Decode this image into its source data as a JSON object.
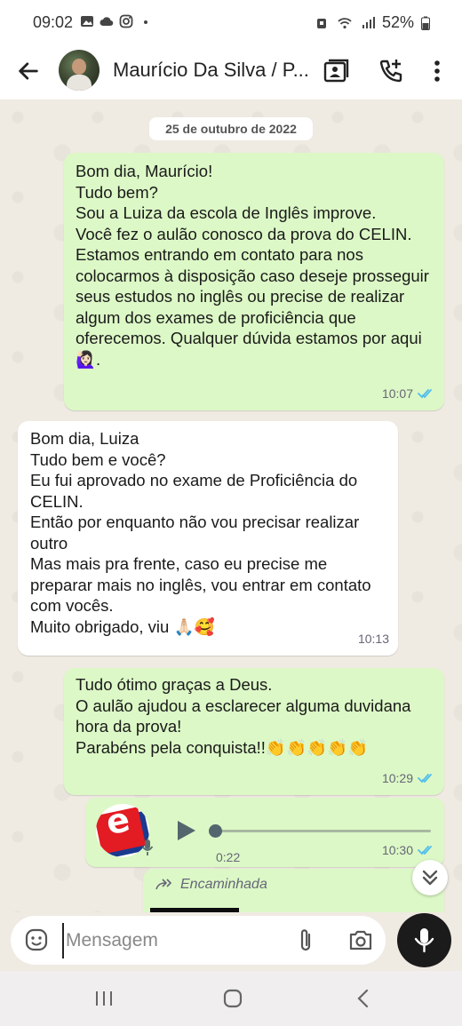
{
  "status_bar": {
    "time": "09:02",
    "battery": "52%"
  },
  "header": {
    "contact_name": "Maurício Da Silva / P..."
  },
  "chat": {
    "date": "25 de outubro de 2022",
    "messages": [
      {
        "direction": "outgoing",
        "text": "Bom dia, Maurício!\nTudo bem?\nSou a Luiza da escola de Inglês improve.\nVocê fez o aulão conosco da prova do CELIN.\nEstamos entrando em contato para nos colocarmos à disposição caso deseje prosseguir seus estudos no inglês ou precise de realizar algum dos exames de proficiência que oferecemos. Qualquer dúvida estamos por aqui 🙋🏻‍♀️.",
        "time": "10:07",
        "read": true
      },
      {
        "direction": "incoming",
        "text": "Bom dia, Luiza\nTudo bem e você?\nEu fui aprovado no exame de Proficiência do CELIN.\nEntão por enquanto não vou precisar realizar outro\nMas mais pra frente, caso eu precise me preparar mais no inglês, vou entrar em contato com vocês.\nMuito obrigado, viu 🙏🏻🥰",
        "time": "10:13"
      },
      {
        "direction": "outgoing",
        "text": "Tudo ótimo graças a Deus.\nO aulão ajudou a esclarecer alguma duvidana hora da prova!\nParabéns pela conquista!!👏👏👏👏👏",
        "time": "10:29",
        "read": true
      },
      {
        "direction": "outgoing",
        "type": "voice",
        "avatar_letter": "e",
        "duration": "0:22",
        "progress": 0,
        "time": "10:30",
        "read": true
      },
      {
        "direction": "outgoing",
        "type": "forwarded",
        "forwarded_label": "Encaminhada"
      }
    ]
  },
  "input": {
    "placeholder": "Mensagem"
  },
  "colors": {
    "outgoing_bubble": "#dcf8c6",
    "incoming_bubble": "#ffffff",
    "read_ticks": "#53bdeb"
  },
  "icons": [
    "back-arrow-icon",
    "contact-card-icon",
    "add-call-icon",
    "more-vert-icon",
    "emoji-icon",
    "attach-icon",
    "camera-icon",
    "mic-icon",
    "play-icon",
    "chevrons-down-icon"
  ]
}
